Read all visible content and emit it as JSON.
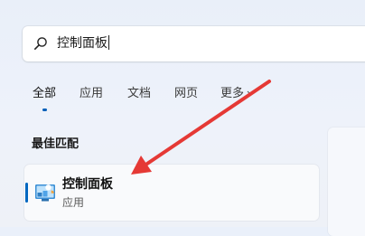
{
  "search": {
    "query": "控制面板"
  },
  "tabs": [
    {
      "label": "全部",
      "active": true
    },
    {
      "label": "应用",
      "active": false
    },
    {
      "label": "文档",
      "active": false
    },
    {
      "label": "网页",
      "active": false
    },
    {
      "label": "更多",
      "active": false,
      "has_dropdown": true
    }
  ],
  "best_match": {
    "section_title": "最佳匹配",
    "name": "控制面板",
    "type": "应用",
    "icon": "control-panel-icon"
  },
  "colors": {
    "accent": "#0067c0",
    "annotation_arrow": "#e53935"
  }
}
